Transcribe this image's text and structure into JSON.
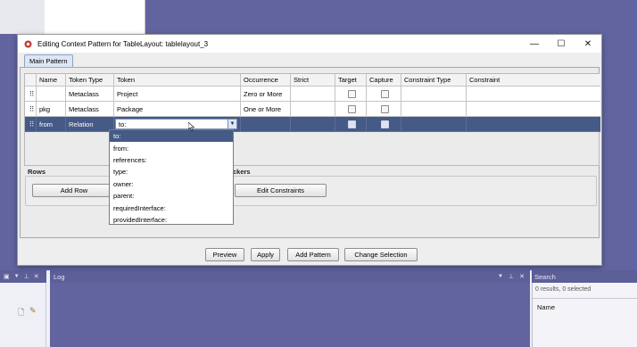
{
  "dialog": {
    "title": "Editing Context Pattern for TableLayout: tablelayout_3",
    "minimize": "—",
    "maximize": "☐",
    "close": "✕",
    "tab": "Main Pattern"
  },
  "table": {
    "headers": [
      "Name",
      "Token Type",
      "Token",
      "Occurrence",
      "Strict",
      "Target",
      "Capture",
      "Constraint Type",
      "Constraint"
    ],
    "rows": [
      {
        "name": "",
        "token_type": "Metaclass",
        "token": "Project",
        "occurrence": "Zero or More",
        "strict": "",
        "constraint_type": "",
        "constraint": ""
      },
      {
        "name": "pkg",
        "token_type": "Metaclass",
        "token": "Package",
        "occurrence": "One or More",
        "strict": "",
        "constraint_type": "",
        "constraint": ""
      },
      {
        "name": "from",
        "token_type": "Relation",
        "token": "to:",
        "occurrence": "",
        "strict": "",
        "constraint_type": "",
        "constraint": ""
      }
    ],
    "grip": "⠿"
  },
  "dropdown": {
    "selected": "to:",
    "arrow": "▼",
    "options": [
      "to:",
      "from:",
      "references:",
      "type:",
      "owner:",
      "parent:",
      "requiredInterface:",
      "providedInterface:"
    ]
  },
  "rows_panel": {
    "label": "Rows",
    "add_row": "Add Row"
  },
  "checkers_panel": {
    "label": "ckers",
    "edit_constraints": "Edit Constraints"
  },
  "footer": {
    "preview": "Preview",
    "apply": "Apply",
    "add_pattern": "Add Pattern",
    "change_selection": "Change Selection"
  },
  "bottom": {
    "log_title": "Log",
    "search_title": "Search",
    "search_status": "0 results, 0 selected",
    "name_header": "Name"
  }
}
